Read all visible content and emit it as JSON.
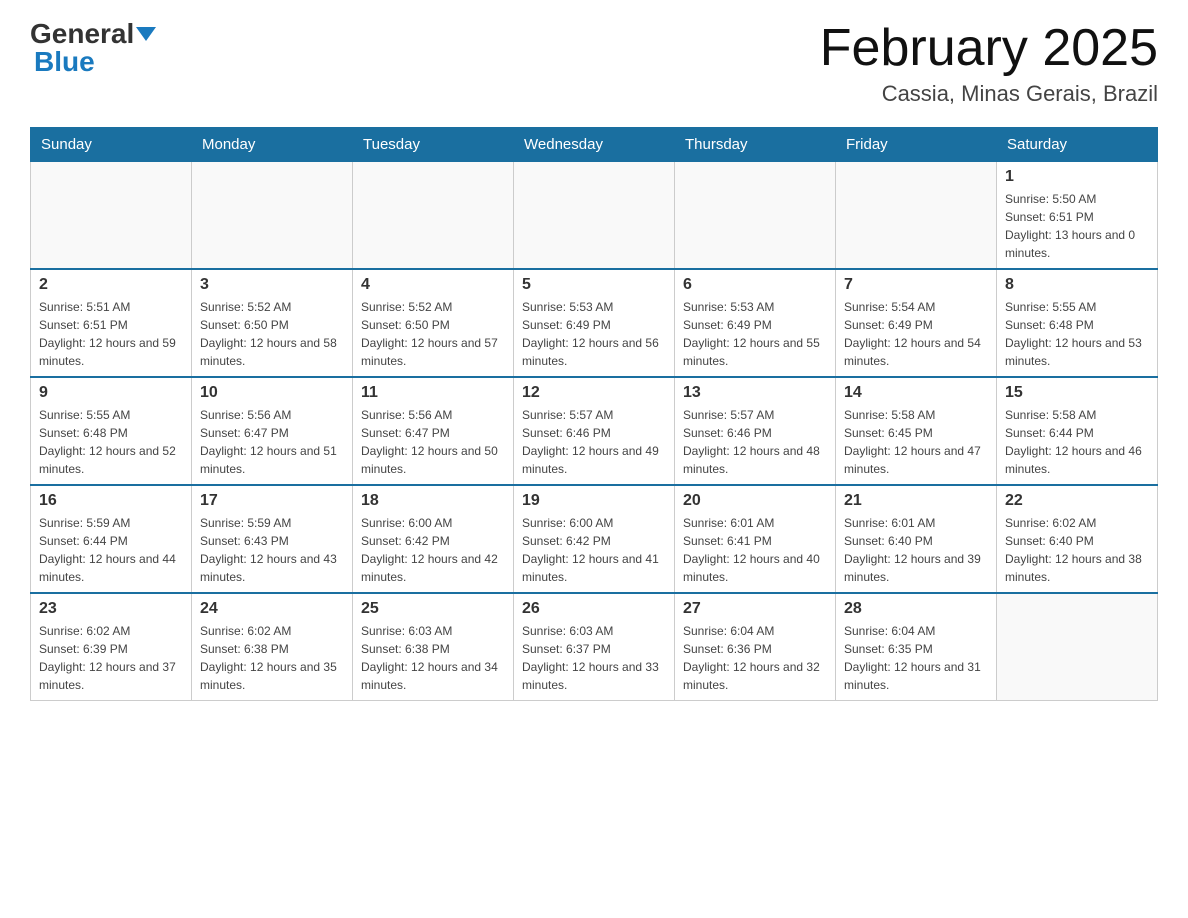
{
  "header": {
    "logo_general": "General",
    "logo_blue": "Blue",
    "month_title": "February 2025",
    "location": "Cassia, Minas Gerais, Brazil"
  },
  "days_of_week": [
    "Sunday",
    "Monday",
    "Tuesday",
    "Wednesday",
    "Thursday",
    "Friday",
    "Saturday"
  ],
  "weeks": [
    {
      "days": [
        {
          "number": "",
          "info": ""
        },
        {
          "number": "",
          "info": ""
        },
        {
          "number": "",
          "info": ""
        },
        {
          "number": "",
          "info": ""
        },
        {
          "number": "",
          "info": ""
        },
        {
          "number": "",
          "info": ""
        },
        {
          "number": "1",
          "info": "Sunrise: 5:50 AM\nSunset: 6:51 PM\nDaylight: 13 hours and 0 minutes."
        }
      ]
    },
    {
      "days": [
        {
          "number": "2",
          "info": "Sunrise: 5:51 AM\nSunset: 6:51 PM\nDaylight: 12 hours and 59 minutes."
        },
        {
          "number": "3",
          "info": "Sunrise: 5:52 AM\nSunset: 6:50 PM\nDaylight: 12 hours and 58 minutes."
        },
        {
          "number": "4",
          "info": "Sunrise: 5:52 AM\nSunset: 6:50 PM\nDaylight: 12 hours and 57 minutes."
        },
        {
          "number": "5",
          "info": "Sunrise: 5:53 AM\nSunset: 6:49 PM\nDaylight: 12 hours and 56 minutes."
        },
        {
          "number": "6",
          "info": "Sunrise: 5:53 AM\nSunset: 6:49 PM\nDaylight: 12 hours and 55 minutes."
        },
        {
          "number": "7",
          "info": "Sunrise: 5:54 AM\nSunset: 6:49 PM\nDaylight: 12 hours and 54 minutes."
        },
        {
          "number": "8",
          "info": "Sunrise: 5:55 AM\nSunset: 6:48 PM\nDaylight: 12 hours and 53 minutes."
        }
      ]
    },
    {
      "days": [
        {
          "number": "9",
          "info": "Sunrise: 5:55 AM\nSunset: 6:48 PM\nDaylight: 12 hours and 52 minutes."
        },
        {
          "number": "10",
          "info": "Sunrise: 5:56 AM\nSunset: 6:47 PM\nDaylight: 12 hours and 51 minutes."
        },
        {
          "number": "11",
          "info": "Sunrise: 5:56 AM\nSunset: 6:47 PM\nDaylight: 12 hours and 50 minutes."
        },
        {
          "number": "12",
          "info": "Sunrise: 5:57 AM\nSunset: 6:46 PM\nDaylight: 12 hours and 49 minutes."
        },
        {
          "number": "13",
          "info": "Sunrise: 5:57 AM\nSunset: 6:46 PM\nDaylight: 12 hours and 48 minutes."
        },
        {
          "number": "14",
          "info": "Sunrise: 5:58 AM\nSunset: 6:45 PM\nDaylight: 12 hours and 47 minutes."
        },
        {
          "number": "15",
          "info": "Sunrise: 5:58 AM\nSunset: 6:44 PM\nDaylight: 12 hours and 46 minutes."
        }
      ]
    },
    {
      "days": [
        {
          "number": "16",
          "info": "Sunrise: 5:59 AM\nSunset: 6:44 PM\nDaylight: 12 hours and 44 minutes."
        },
        {
          "number": "17",
          "info": "Sunrise: 5:59 AM\nSunset: 6:43 PM\nDaylight: 12 hours and 43 minutes."
        },
        {
          "number": "18",
          "info": "Sunrise: 6:00 AM\nSunset: 6:42 PM\nDaylight: 12 hours and 42 minutes."
        },
        {
          "number": "19",
          "info": "Sunrise: 6:00 AM\nSunset: 6:42 PM\nDaylight: 12 hours and 41 minutes."
        },
        {
          "number": "20",
          "info": "Sunrise: 6:01 AM\nSunset: 6:41 PM\nDaylight: 12 hours and 40 minutes."
        },
        {
          "number": "21",
          "info": "Sunrise: 6:01 AM\nSunset: 6:40 PM\nDaylight: 12 hours and 39 minutes."
        },
        {
          "number": "22",
          "info": "Sunrise: 6:02 AM\nSunset: 6:40 PM\nDaylight: 12 hours and 38 minutes."
        }
      ]
    },
    {
      "days": [
        {
          "number": "23",
          "info": "Sunrise: 6:02 AM\nSunset: 6:39 PM\nDaylight: 12 hours and 37 minutes."
        },
        {
          "number": "24",
          "info": "Sunrise: 6:02 AM\nSunset: 6:38 PM\nDaylight: 12 hours and 35 minutes."
        },
        {
          "number": "25",
          "info": "Sunrise: 6:03 AM\nSunset: 6:38 PM\nDaylight: 12 hours and 34 minutes."
        },
        {
          "number": "26",
          "info": "Sunrise: 6:03 AM\nSunset: 6:37 PM\nDaylight: 12 hours and 33 minutes."
        },
        {
          "number": "27",
          "info": "Sunrise: 6:04 AM\nSunset: 6:36 PM\nDaylight: 12 hours and 32 minutes."
        },
        {
          "number": "28",
          "info": "Sunrise: 6:04 AM\nSunset: 6:35 PM\nDaylight: 12 hours and 31 minutes."
        },
        {
          "number": "",
          "info": ""
        }
      ]
    }
  ]
}
